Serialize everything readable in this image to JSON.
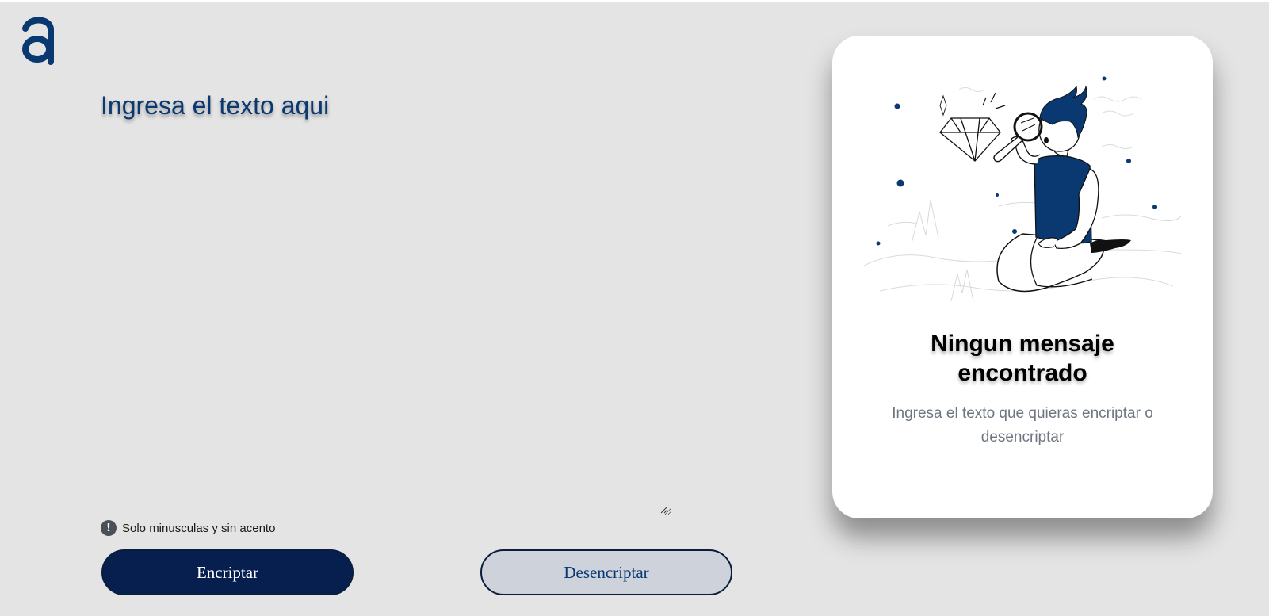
{
  "input": {
    "placeholder": "Ingresa el texto aqui",
    "value": ""
  },
  "hint": {
    "icon": "exclamation-circle-icon",
    "text": "Solo minusculas y sin acento"
  },
  "buttons": {
    "encrypt_label": "Encriptar",
    "decrypt_label": "Desencriptar"
  },
  "output": {
    "title_line1": "Ningun mensaje",
    "title_line2": "encontrado",
    "subtitle": "Ingresa el texto que quieras encriptar o desencriptar"
  },
  "colors": {
    "brand": "#0a3871",
    "button_primary": "#061f4f",
    "button_secondary": "#ced3db",
    "background": "#e4e4e4"
  }
}
